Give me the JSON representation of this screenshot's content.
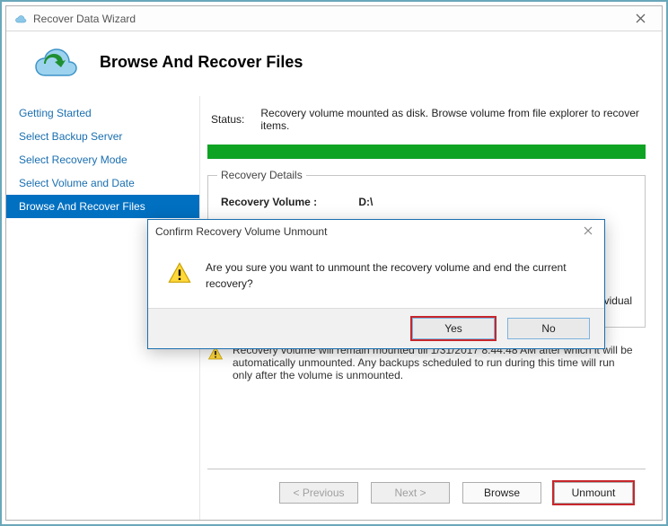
{
  "window": {
    "title": "Recover Data Wizard"
  },
  "header": {
    "page_title": "Browse And Recover Files"
  },
  "sidebar": {
    "items": [
      {
        "label": "Getting Started",
        "active": false
      },
      {
        "label": "Select Backup Server",
        "active": false
      },
      {
        "label": "Select Recovery Mode",
        "active": false
      },
      {
        "label": "Select Volume and Date",
        "active": false
      },
      {
        "label": "Browse And Recover Files",
        "active": true
      }
    ]
  },
  "content": {
    "status_label": "Status:",
    "status_text": "Recovery volume mounted as disk. Browse volume from file explorer to recover items.",
    "details": {
      "box_label": "Recovery Details",
      "volume_label": "Recovery Volume   :",
      "volume_value": "D:\\",
      "tip_partial": "cover individual"
    },
    "note_text": "Recovery volume will remain mounted till 1/31/2017 8:44:48 AM after which it will be automatically unmounted. Any backups scheduled to run during this time will run only after the volume is unmounted."
  },
  "footer": {
    "previous": "< Previous",
    "next": "Next >",
    "browse": "Browse",
    "unmount": "Unmount"
  },
  "modal": {
    "title": "Confirm Recovery Volume Unmount",
    "message": "Are you sure you want to unmount the recovery volume and end the current recovery?",
    "yes": "Yes",
    "no": "No"
  }
}
